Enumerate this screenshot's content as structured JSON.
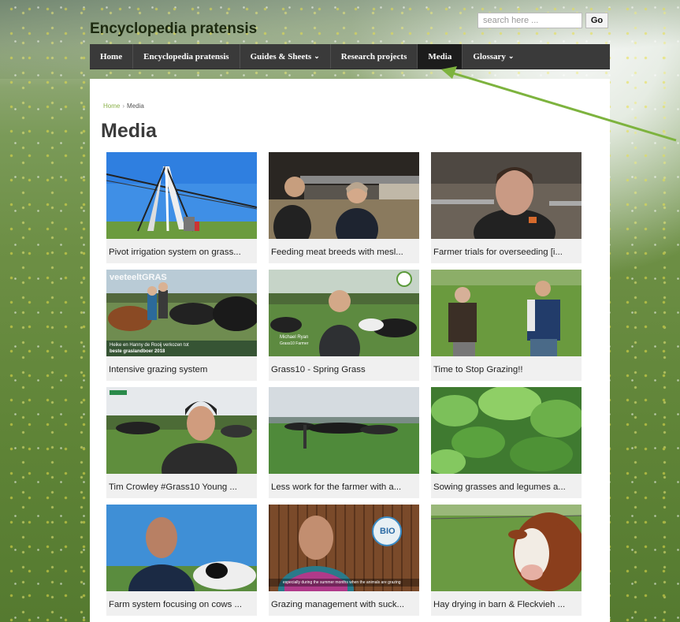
{
  "site": {
    "title": "Encyclopedia pratensis"
  },
  "search": {
    "placeholder": "search here ...",
    "go_label": "Go"
  },
  "nav": {
    "items": [
      {
        "label": "Home",
        "dropdown": false,
        "active": false
      },
      {
        "label": "Encyclopedia pratensis",
        "dropdown": false,
        "active": false
      },
      {
        "label": "Guides & Sheets",
        "dropdown": true,
        "active": false
      },
      {
        "label": "Research projects",
        "dropdown": false,
        "active": false
      },
      {
        "label": "Media",
        "dropdown": false,
        "active": true
      },
      {
        "label": "Glossary",
        "dropdown": true,
        "active": false
      }
    ],
    "caret": "⌄"
  },
  "breadcrumb": {
    "home": "Home",
    "separator": "›",
    "current": "Media"
  },
  "page": {
    "title": "Media"
  },
  "videos": [
    {
      "title": "Pivot irrigation system on grass..."
    },
    {
      "title": "Feeding meat breeds with mesl..."
    },
    {
      "title": "Farmer trials for overseeding [i..."
    },
    {
      "title": "Intensive grazing system",
      "overlay_brand": "veeteeltGRAS",
      "overlay_line1": "Heike en Hanny de Rooij verkozen tot",
      "overlay_line2": "beste graslandboer 2018"
    },
    {
      "title": "Grass10 - Spring Grass",
      "overlay_line1": "Michael Ryan",
      "overlay_line2": "Grass10 Farmer"
    },
    {
      "title": "Time to Stop Grazing!!"
    },
    {
      "title": "Tim Crowley #Grass10 Young ..."
    },
    {
      "title": "Less work for the farmer with a..."
    },
    {
      "title": "Sowing grasses and legumes a..."
    },
    {
      "title": "Farm system focusing on cows ..."
    },
    {
      "title": "Grazing management with suck...",
      "overlay_badge": "BIO",
      "overlay_line1": "especially during the summer months when the animals are grazing"
    },
    {
      "title": "Hay drying in barn & Fleckvieh ..."
    }
  ],
  "colors": {
    "nav_bg": "#3a3a3a",
    "nav_active": "#1c1c1c",
    "breadcrumb_link": "#8bb14a",
    "arrow": "#7db33e"
  }
}
